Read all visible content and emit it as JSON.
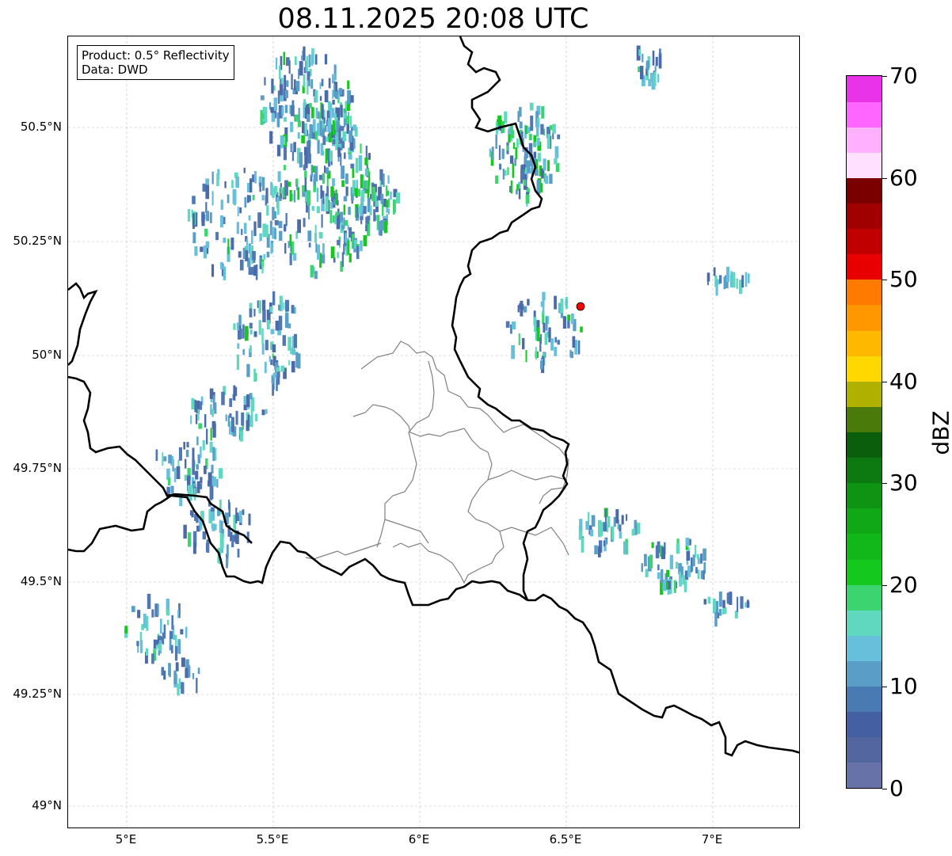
{
  "title": "08.11.2025 20:08 UTC",
  "info_box": {
    "line1": "Product: 0.5° Reflectivity",
    "line2": "Data: DWD"
  },
  "lat_labels": [
    "50.5°N",
    "50.25°N",
    "50°N",
    "49.75°N",
    "49.5°N",
    "49.25°N",
    "49°N"
  ],
  "lon_labels": [
    "5°E",
    "5.5°E",
    "6°E",
    "6.5°E",
    "7°E"
  ],
  "colorbar": {
    "label": "dBZ",
    "tick_labels": [
      "0",
      "10",
      "20",
      "30",
      "40",
      "50",
      "60",
      "70"
    ],
    "colors": [
      "#6672a8",
      "#5466a0",
      "#4460a2",
      "#4a7ab2",
      "#5a9ec8",
      "#66c0dc",
      "#60d8c0",
      "#3cd470",
      "#14c81e",
      "#12b81a",
      "#10a816",
      "#0e9412",
      "#0c7a10",
      "#0a5e0c",
      "#4a7a0a",
      "#b0b000",
      "#ffd800",
      "#ffb800",
      "#ff9800",
      "#ff7a00",
      "#e80000",
      "#c00000",
      "#a00000",
      "#7a0000",
      "#ffe0ff",
      "#ffb0ff",
      "#ff66ff",
      "#e833e8"
    ]
  },
  "map": {
    "background": "#ffffff",
    "border_color": "#000000",
    "admin_color": "#808080",
    "marker_color": "#ff0000"
  }
}
